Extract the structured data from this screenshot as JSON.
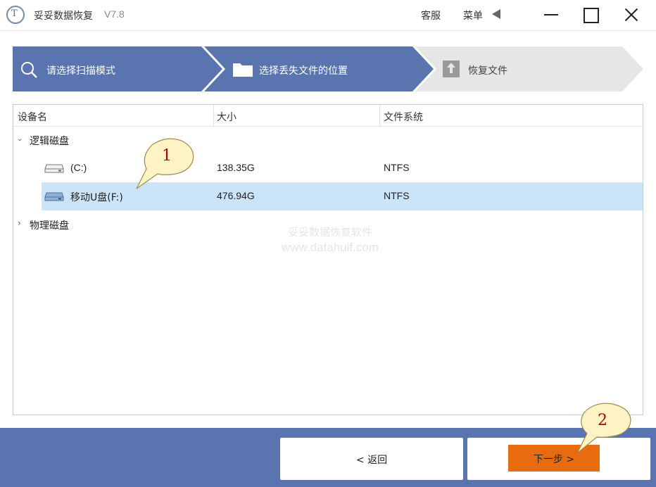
{
  "window": {
    "title": "妥妥数据恢复",
    "version": "V7.8",
    "logo_text": "T",
    "help_label": "客服",
    "menu_label": "菜单"
  },
  "steps": [
    {
      "label": "请选择扫描模式",
      "icon": "search-icon",
      "state": "done"
    },
    {
      "label": "选择丢失文件的位置",
      "icon": "folder-icon",
      "state": "active"
    },
    {
      "label": "恢复文件",
      "icon": "upload-icon",
      "state": "pending"
    }
  ],
  "table": {
    "columns": [
      "设备名",
      "大小",
      "文件系统"
    ],
    "groups": [
      {
        "name": "逻辑磁盘",
        "expanded": true,
        "rows": [
          {
            "name": "(C:)",
            "size": "138.35G",
            "fs": "NTFS",
            "selected": false
          },
          {
            "name": "移动U盘(F:)",
            "size": "476.94G",
            "fs": "NTFS",
            "selected": true
          }
        ]
      },
      {
        "name": "物理磁盘",
        "expanded": false,
        "rows": []
      }
    ]
  },
  "watermark": {
    "line1": "妥妥数据恢复软件",
    "line2": "www.datahuif.com"
  },
  "footer": {
    "back_label": "< 返回",
    "next_label": "下一步 >"
  },
  "callouts": [
    "1",
    "2"
  ],
  "colors": {
    "accent_blue": "#5a74b0",
    "selected_row": "#cce4f7",
    "next_button": "#e86b10",
    "callout_fill": "#fdf3c4",
    "callout_number": "#b30000"
  }
}
